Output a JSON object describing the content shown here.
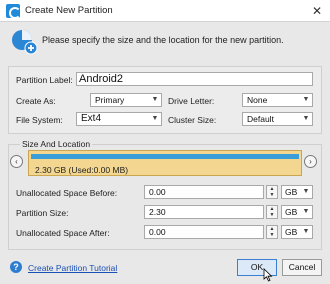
{
  "window": {
    "title": "Create New Partition",
    "close_glyph": "✕"
  },
  "header": {
    "text": "Please specify the size and the location for the new partition."
  },
  "form": {
    "partition_label": {
      "label": "Partition Label:",
      "value": "Android2"
    },
    "create_as": {
      "label": "Create As:",
      "value": "Primary"
    },
    "drive_letter": {
      "label": "Drive Letter:",
      "value": "None"
    },
    "file_system": {
      "label": "File System:",
      "value": "Ext4"
    },
    "cluster_size": {
      "label": "Cluster Size:",
      "value": "Default"
    }
  },
  "size_location": {
    "title": "Size And Location",
    "partition_bar_text": "2.30 GB (Used:0.00 MB)",
    "used_fraction": 1.0,
    "unallocated_before": {
      "label": "Unallocated Space Before:",
      "value": "0.00",
      "unit": "GB"
    },
    "partition_size": {
      "label": "Partition Size:",
      "value": "2.30",
      "unit": "GB"
    },
    "unallocated_after": {
      "label": "Unallocated Space After:",
      "value": "0.00",
      "unit": "GB"
    }
  },
  "footer": {
    "help_link": "Create Partition Tutorial",
    "ok_label": "OK",
    "cancel_label": "Cancel"
  },
  "colors": {
    "partition_bar": "#f3d790",
    "partition_fill": "#3a9fd9",
    "link": "#1a4fb5"
  }
}
